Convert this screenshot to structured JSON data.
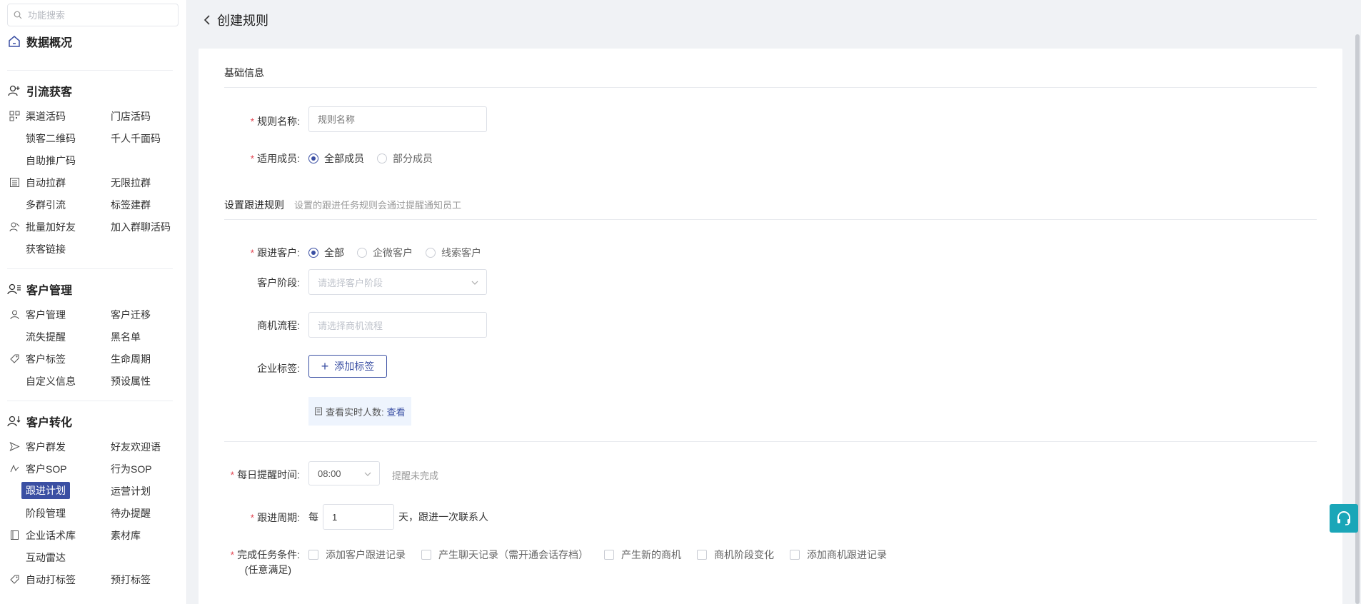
{
  "sidebar": {
    "search_placeholder": "功能搜索",
    "overview": "数据概况",
    "sections": {
      "traffic": {
        "title": "引流获客",
        "rows": [
          [
            "渠道活码",
            "门店活码"
          ],
          [
            "锁客二维码",
            "千人千面码"
          ],
          [
            "自助推广码",
            ""
          ],
          [
            "自动拉群",
            "无限拉群"
          ],
          [
            "多群引流",
            "标签建群"
          ],
          [
            "批量加好友",
            "加入群聊活码"
          ],
          [
            "获客链接",
            ""
          ]
        ]
      },
      "customer": {
        "title": "客户管理",
        "rows": [
          [
            "客户管理",
            "客户迁移"
          ],
          [
            "流失提醒",
            "黑名单"
          ],
          [
            "客户标签",
            "生命周期"
          ],
          [
            "自定义信息",
            "预设属性"
          ]
        ]
      },
      "conversion": {
        "title": "客户转化",
        "rows": [
          [
            "客户群发",
            "好友欢迎语"
          ],
          [
            "客户SOP",
            "行为SOP"
          ],
          [
            "跟进计划",
            "运营计划"
          ],
          [
            "阶段管理",
            "待办提醒"
          ],
          [
            "企业话术库",
            "素材库"
          ],
          [
            "互动雷达",
            ""
          ],
          [
            "自动打标签",
            "预打标签"
          ]
        ]
      }
    }
  },
  "header": {
    "title": "创建规则"
  },
  "form": {
    "basic_title": "基础信息",
    "rule_name_label": "规则名称:",
    "rule_name_placeholder": "规则名称",
    "members_label": "适用成员:",
    "members_options": [
      "全部成员",
      "部分成员"
    ],
    "follow_title": "设置跟进规则",
    "follow_hint": "设置的跟进任务规则会通过提醒通知员工",
    "follow_customer_label": "跟进客户:",
    "follow_customer_options": [
      "全部",
      "企微客户",
      "线索客户"
    ],
    "stage_label": "客户阶段:",
    "stage_placeholder": "请选择客户阶段",
    "opportunity_label": "商机流程:",
    "opportunity_placeholder": "请选择商机流程",
    "tag_label": "企业标签:",
    "add_tag_button": "添加标签",
    "realtime_text": "查看实时人数:",
    "realtime_link": "查看",
    "remind_time_label": "每日提醒时间:",
    "remind_time_value": "08:00",
    "remind_hint": "提醒未完成",
    "cycle_label": "跟进周期:",
    "cycle_prefix": "每",
    "cycle_value": "1",
    "cycle_suffix": "天，跟进一次联系人",
    "complete_label": "完成任务条件:",
    "complete_sub": "(任意满足)",
    "complete_options": [
      "添加客户跟进记录",
      "产生聊天记录（需开通会话存档）",
      "产生新的商机",
      "商机阶段变化",
      "添加商机跟进记录"
    ]
  },
  "colors": {
    "primary": "#3a4fa3",
    "required": "#e34d59",
    "float": "#1aa6b8"
  }
}
